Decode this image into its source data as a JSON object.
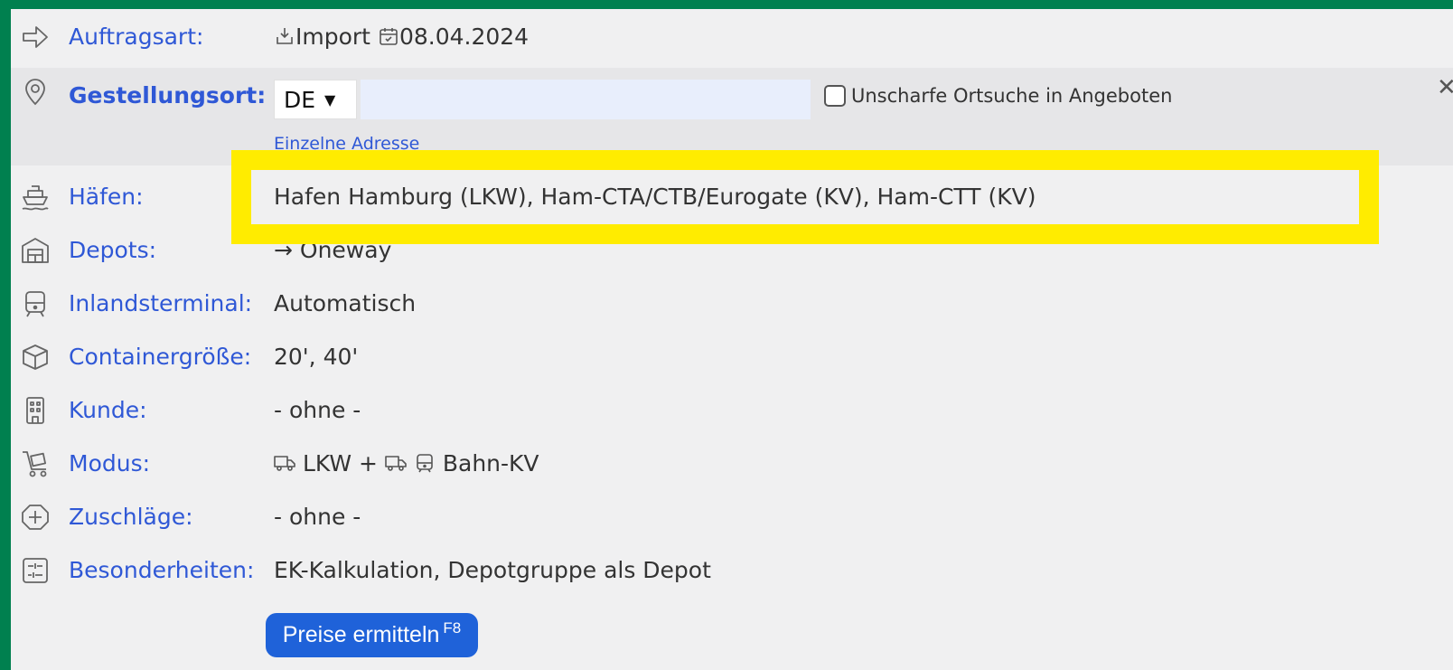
{
  "rows": [
    {
      "label": "Auftragsart:",
      "icon": "arrow-right-icon",
      "value_type": "import",
      "value_text": "Import",
      "date": "08.04.2024"
    },
    {
      "label": "Gestellungsort:",
      "icon": "map-pin-icon",
      "country": "DE",
      "checkbox_label": "Unscharfe Ortsuche in Angeboten",
      "link_text": "Einzelne Adresse",
      "checked": false
    },
    {
      "label": "Häfen:",
      "icon": "ship-icon",
      "value": "Hafen Hamburg (LKW), Ham-CTA/CTB/Eurogate (KV), Ham-CTT (KV)"
    },
    {
      "label": "Depots:",
      "icon": "warehouse-icon",
      "value": "→ Oneway"
    },
    {
      "label": "Inlandsterminal:",
      "icon": "train-icon",
      "value": "Automatisch"
    },
    {
      "label": "Containergröße:",
      "icon": "box-icon",
      "value": "20', 40'"
    },
    {
      "label": "Kunde:",
      "icon": "building-icon",
      "value": "- ohne -"
    },
    {
      "label": "Modus:",
      "icon": "cart-icon",
      "modus_lkw": "LKW +",
      "modus_bahn": "Bahn-KV"
    },
    {
      "label": "Zuschläge:",
      "icon": "plus-circle-icon",
      "value": "- ohne -"
    },
    {
      "label": "Besonderheiten:",
      "icon": "sliders-icon",
      "value": "EK-Kalkulation, Depotgruppe als Depot"
    }
  ],
  "button": {
    "label": "Preise ermitteln",
    "shortcut": "F8"
  },
  "colors": {
    "frame": "#00804f",
    "panel": "#f0f0f1",
    "label": "#2f58d6",
    "highlight": "#ffec00",
    "button": "#1f62d9"
  }
}
